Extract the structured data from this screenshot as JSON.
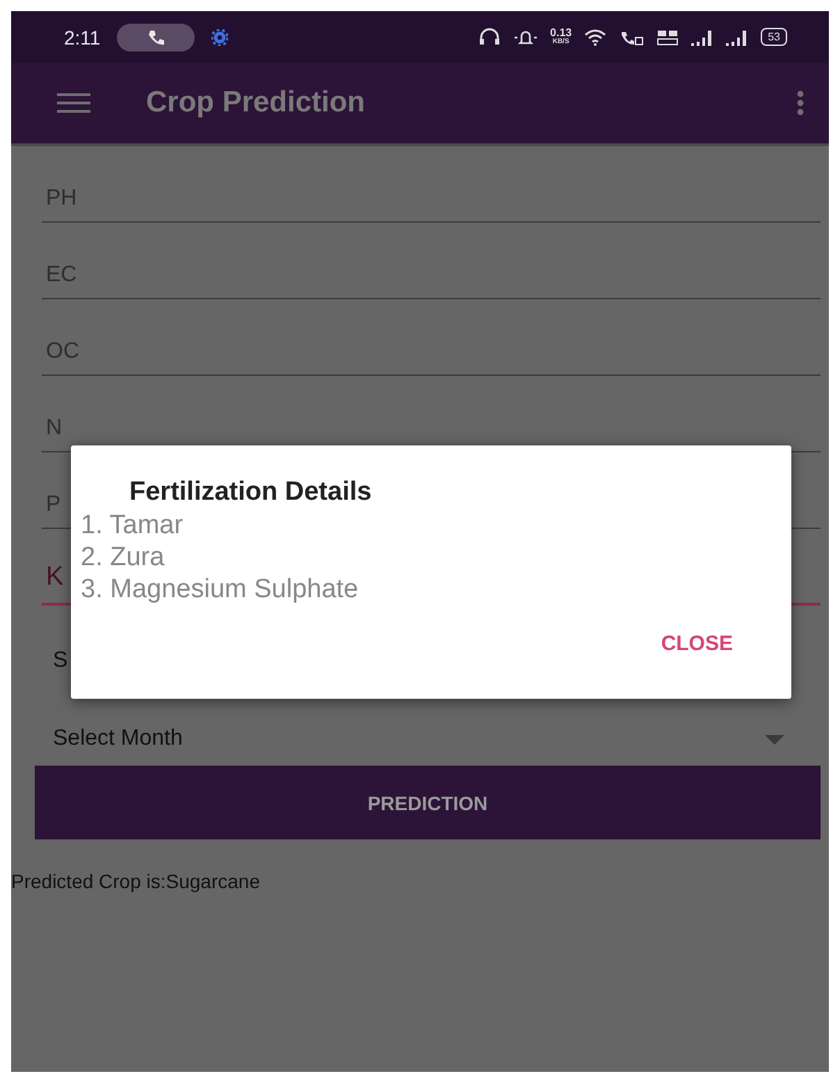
{
  "status_bar": {
    "time": "2:11",
    "net_speed": "0.13",
    "net_unit": "KB/S",
    "battery": "53"
  },
  "app_bar": {
    "title": "Crop Prediction"
  },
  "fields": [
    {
      "label": "PH",
      "focused": false
    },
    {
      "label": "EC",
      "focused": false
    },
    {
      "label": "OC",
      "focused": false
    },
    {
      "label": "N",
      "focused": false
    },
    {
      "label": "P",
      "focused": false
    },
    {
      "label": "K",
      "focused": true
    }
  ],
  "spinners": [
    {
      "text": "S",
      "kind": "label"
    },
    {
      "text": "Select Month",
      "kind": "dropdown"
    }
  ],
  "predict_button": {
    "label": "PREDICTION"
  },
  "result": "Predicted Crop is:Sugarcane",
  "dialog": {
    "title": "Fertilization Details",
    "items": [
      "1. Tamar",
      "2. Zura",
      "3. Magnesium Sulphate"
    ],
    "button": "CLOSE"
  }
}
